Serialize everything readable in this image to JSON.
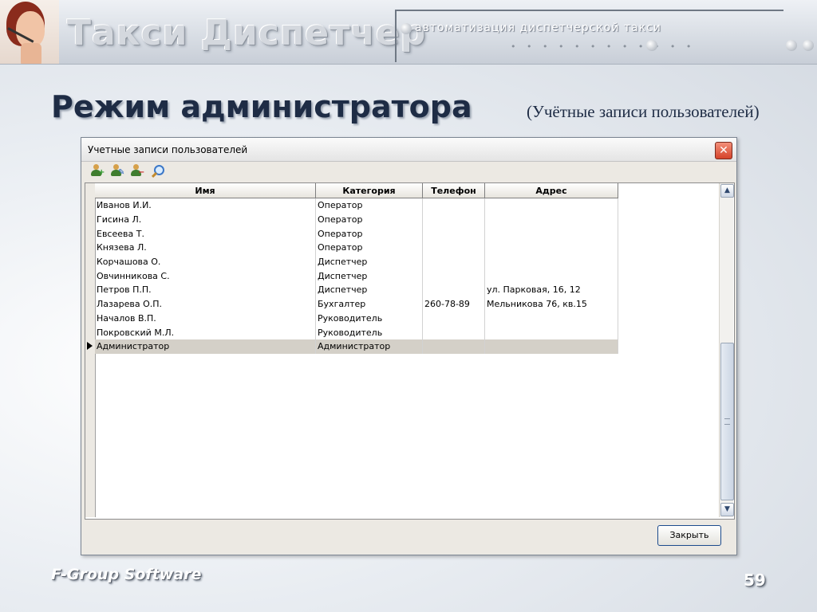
{
  "header": {
    "brand": "Такси Диспетчер",
    "tagline": "автоматизация диспетчерской такси",
    "dots": "• • • • • • • • • • • •"
  },
  "slide": {
    "title": "Режим администратора",
    "subtitle": "(Учётные записи пользователей)"
  },
  "window": {
    "title": "Учетные записи пользователей",
    "close_glyph": "✕",
    "toolbar": [
      {
        "icon": "add-user-icon",
        "badge": "+",
        "badge_color": "#2f9b2f"
      },
      {
        "icon": "edit-user-icon",
        "badge": "✎",
        "badge_color": "#1f5fbf"
      },
      {
        "icon": "delete-user-icon",
        "badge": "−",
        "badge_color": "#cf2f2f"
      },
      {
        "icon": "search-icon"
      }
    ],
    "columns": [
      "Имя",
      "Категория",
      "Телефон",
      "Адрес"
    ],
    "rows": [
      [
        "Иванов И.И.",
        "Оператор",
        "",
        ""
      ],
      [
        "Гисина Л.",
        "Оператор",
        "",
        ""
      ],
      [
        "Евсеева Т.",
        "Оператор",
        "",
        ""
      ],
      [
        "Князева Л.",
        "Оператор",
        "",
        ""
      ],
      [
        "Корчашова О.",
        "Диспетчер",
        "",
        ""
      ],
      [
        "Овчинникова С.",
        "Диспетчер",
        "",
        ""
      ],
      [
        "Петров П.П.",
        "Диспетчер",
        "",
        "ул. Парковая, 16, 12"
      ],
      [
        "Лазарева О.П.",
        "Бухгалтер",
        "260-78-89",
        "Мельникова 76, кв.15"
      ],
      [
        "Началов В.П.",
        "Руководитель",
        "",
        ""
      ],
      [
        "Покровский М.Л.",
        "Руководитель",
        "",
        ""
      ],
      [
        "Администратор",
        "Администратор",
        "",
        ""
      ]
    ],
    "selected_row": 10,
    "scroll_up": "▲",
    "scroll_down": "▼",
    "close_button": "Закрыть"
  },
  "footer": {
    "brand": "F-Group Software",
    "page_number": "59"
  },
  "colors": {
    "title_text": "#1e2c45",
    "selected_row": "#d4d0c8",
    "close_red": "#d5432a"
  }
}
